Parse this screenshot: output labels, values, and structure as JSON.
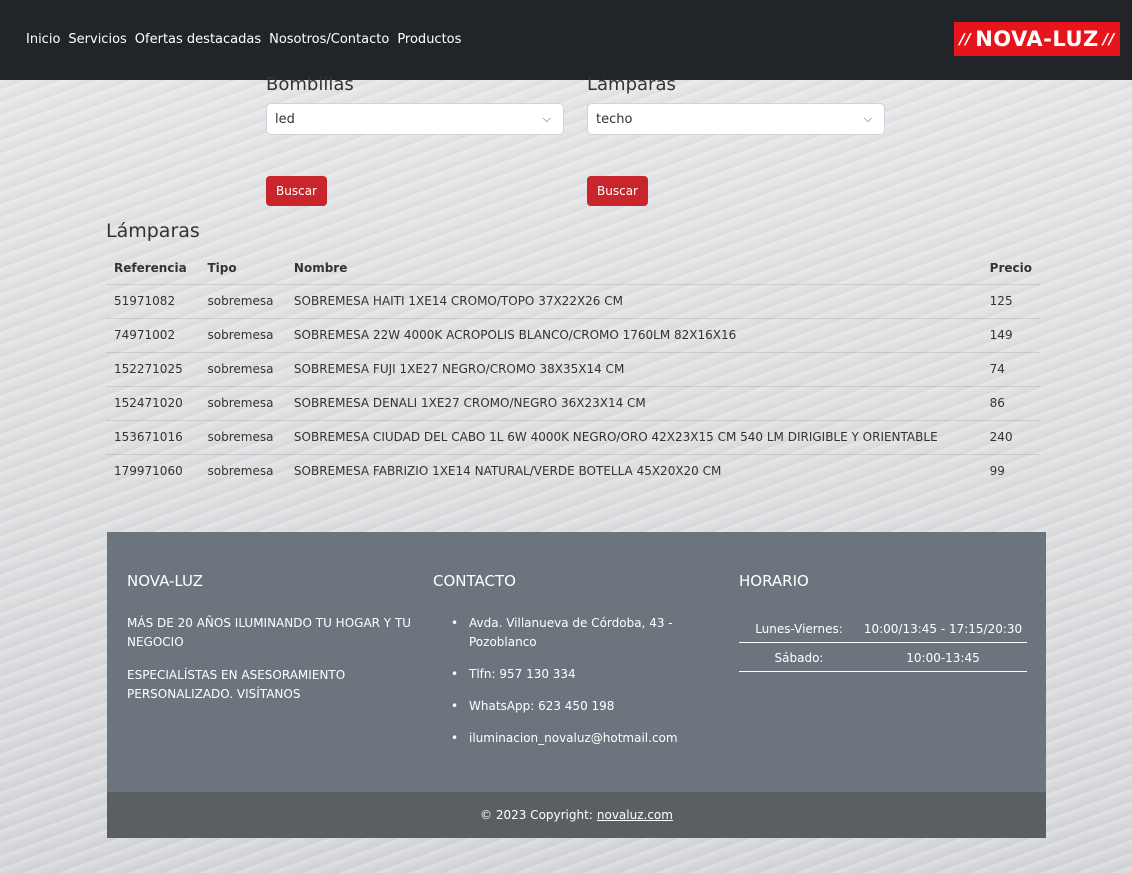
{
  "nav": {
    "items": [
      "Inicio",
      "Servicios",
      "Ofertas destacadas",
      "Nosotros/Contacto",
      "Productos"
    ],
    "logo": "NOVA-LUZ"
  },
  "search": {
    "bombillas": {
      "label": "Bombillas",
      "selected": "led",
      "button": "Buscar"
    },
    "lamparas": {
      "label": "Lámparas",
      "selected": "techo",
      "button": "Buscar"
    }
  },
  "results": {
    "title": "Lámparas",
    "columns": [
      "Referencia",
      "Tipo",
      "Nombre",
      "Precio"
    ],
    "rows": [
      [
        "51971082",
        "sobremesa",
        "SOBREMESA HAITI 1XE14 CROMO/TOPO 37X22X26 CM",
        "125"
      ],
      [
        "74971002",
        "sobremesa",
        "SOBREMESA 22W 4000K ACROPOLIS BLANCO/CROMO 1760LM 82X16X16",
        "149"
      ],
      [
        "152271025",
        "sobremesa",
        "SOBREMESA FUJI 1XE27 NEGRO/CROMO 38X35X14 CM",
        "74"
      ],
      [
        "152471020",
        "sobremesa",
        "SOBREMESA DENALI 1XE27 CROMO/NEGRO 36X23X14 CM",
        "86"
      ],
      [
        "153671016",
        "sobremesa",
        "SOBREMESA CIUDAD DEL CABO 1L 6W 4000K NEGRO/ORO 42X23X15 CM 540 LM DIRIGIBLE Y ORIENTABLE",
        "240"
      ],
      [
        "179971060",
        "sobremesa",
        "SOBREMESA FABRIZIO 1XE14 NATURAL/VERDE BOTELLA 45X20X20 CM",
        "99"
      ]
    ]
  },
  "footer": {
    "brand": {
      "title": "NOVA-LUZ",
      "line1": "MÁS DE 20 AÑOS ILUMINANDO TU HOGAR Y TU NEGOCIO",
      "line2": "ESPECIALÍSTAS EN ASESORAMIENTO PERSONALIZADO. VISÍTANOS"
    },
    "contact": {
      "title": "CONTACTO",
      "items": [
        "Avda. Villanueva de Córdoba, 43 - Pozoblanco",
        "Tlfn: 957 130 334",
        "WhatsApp: 623 450 198",
        "iluminacion_novaluz@hotmail.com"
      ]
    },
    "hours": {
      "title": "HORARIO",
      "rows": [
        [
          "Lunes-Viernes:",
          "10:00/13:45 - 17:15/20:30"
        ],
        [
          "Sábado:",
          "10:00-13:45"
        ]
      ]
    },
    "copyright": {
      "text": "© 2023 Copyright:",
      "link": "novaluz.com"
    }
  },
  "colors": {
    "topbar": "#212529",
    "logo_bg": "#e8141b",
    "button": "#c8262c",
    "footer": "#6c757d",
    "footer_bottom": "#595f63"
  }
}
